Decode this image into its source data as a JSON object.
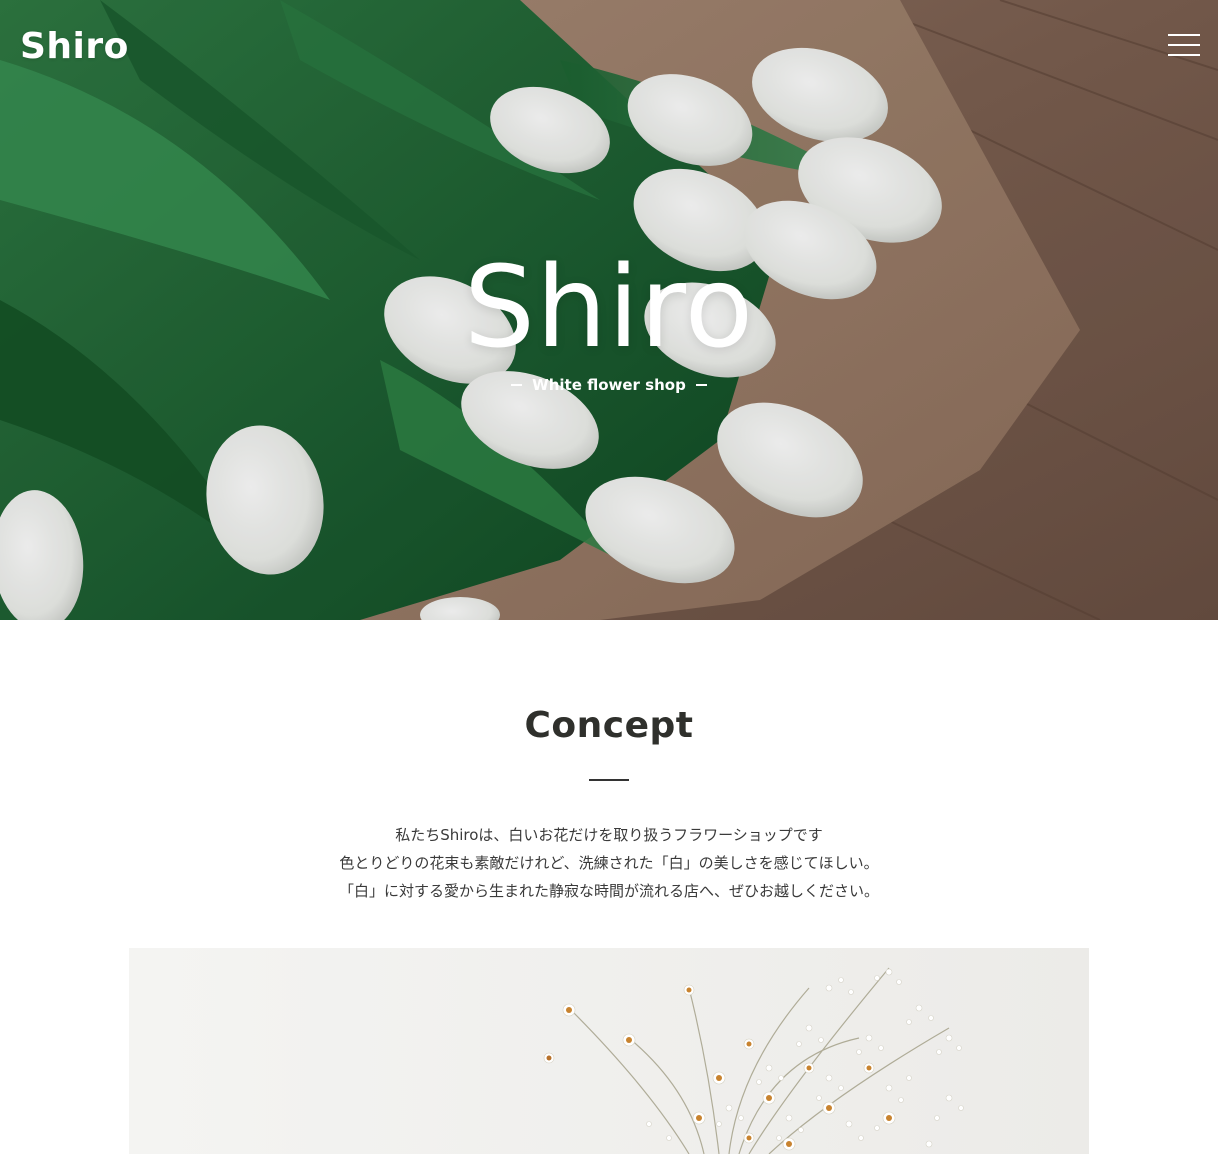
{
  "header": {
    "logo": "Shiro",
    "menu_icon": "hamburger-menu-icon"
  },
  "hero": {
    "title": "Shiro",
    "subtitle": "White flower shop",
    "image_icon": "white-tulip-bouquet-photo"
  },
  "concept": {
    "heading": "Concept",
    "lines": [
      "私たちShiroは、白いお花だけを取り扱うフラワーショップです",
      "色とりどりの花束も素敵だけれど、洗練された「白」の美しさを感じてほしい。",
      "「白」に対する愛から生まれた静寂な時間が流れる店へ、ぜひお越しください。"
    ],
    "image_icon": "dried-flowers-vase-photo"
  },
  "colors": {
    "heading_text": "#2f302c",
    "body_text": "#3a3a3a",
    "background": "#ffffff",
    "overlay_text": "#ffffff"
  }
}
